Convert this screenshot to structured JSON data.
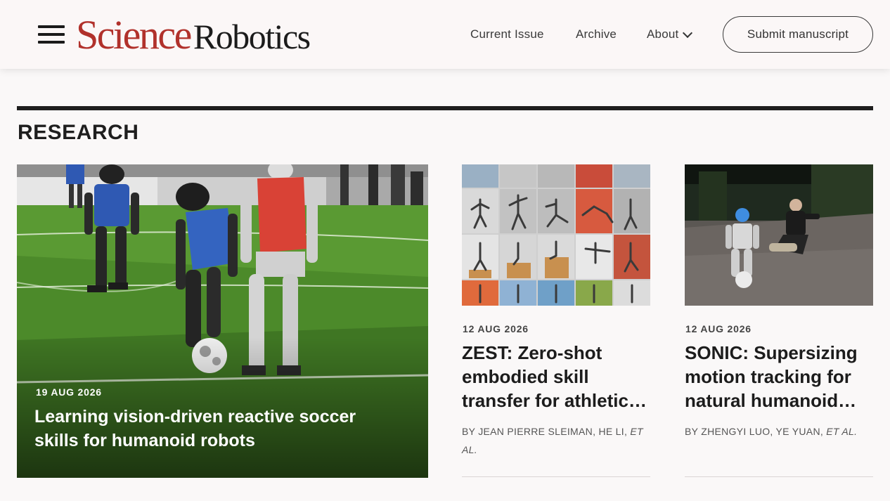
{
  "header": {
    "logo_science": "Science",
    "logo_robotics": "Robotics",
    "nav": {
      "current_issue": "Current Issue",
      "archive": "Archive",
      "about": "About"
    },
    "submit_label": "Submit manuscript"
  },
  "section": {
    "title": "RESEARCH"
  },
  "featured": {
    "date": "19 AUG 2026",
    "title": "Learning vision-driven reactive soccer skills for humanoid robots"
  },
  "cards": [
    {
      "date": "12 AUG 2026",
      "title": "ZEST: Zero-shot embodied skill transfer for athletic…",
      "authors_prefix": "BY JEAN PIERRE SLEIMAN,  HE LI,",
      "authors_etal": "ET AL."
    },
    {
      "date": "12 AUG 2026",
      "title": "SONIC: Supersizing motion tracking for natural humanoid…",
      "authors_prefix": "BY ZHENGYI LUO,  YE YUAN,",
      "authors_etal": "ET AL."
    }
  ],
  "icons": {
    "menu": "hamburger-menu-icon",
    "about_dropdown": "chevron-down-icon"
  },
  "colors": {
    "brand_red": "#b1312b",
    "text_dark": "#1c1c1c",
    "rule": "#1e1e1e"
  }
}
